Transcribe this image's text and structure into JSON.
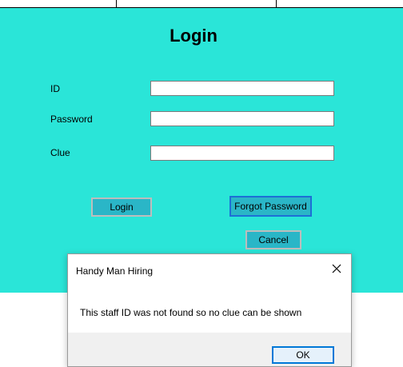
{
  "login_form": {
    "title": "Login",
    "fields": [
      {
        "label": "ID",
        "value": ""
      },
      {
        "label": "Password",
        "value": ""
      },
      {
        "label": "Clue",
        "value": ""
      }
    ],
    "buttons": {
      "login": "Login",
      "forgot_password": "Forgot Password",
      "cancel": "Cancel"
    },
    "background_color": "#2ae5d8",
    "button_color": "#2ab6c7"
  },
  "dialog": {
    "title": "Handy Man Hiring",
    "message": "This staff ID was not found so no clue can be shown",
    "ok_label": "OK",
    "close_icon": "close-icon"
  }
}
